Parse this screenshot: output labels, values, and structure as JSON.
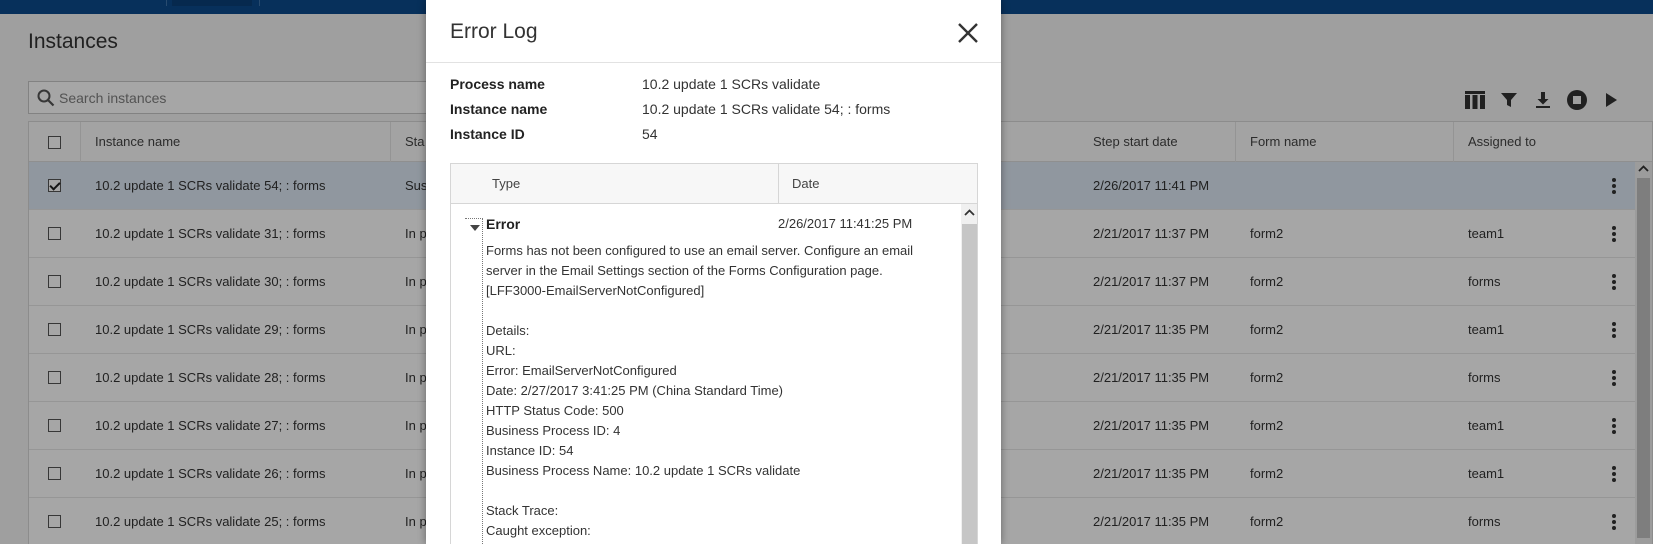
{
  "page": {
    "title": "Instances",
    "search_placeholder": "Search instances"
  },
  "toolbar": {
    "icons": [
      "columns-icon",
      "filter-icon",
      "download-icon",
      "stop-icon",
      "play-icon"
    ]
  },
  "grid": {
    "columns": [
      "Instance name",
      "Sta",
      "Step start date",
      "Form name",
      "Assigned to"
    ],
    "rows": [
      {
        "name": "10.2 update 1 SCRs validate 54; : forms",
        "status": "Sus",
        "step_start": "2/26/2017 11:41 PM",
        "form": "",
        "assigned": "",
        "checked": true
      },
      {
        "name": "10.2 update 1 SCRs validate 31; : forms",
        "status": "In p",
        "step_start": "2/21/2017 11:37 PM",
        "form": "form2",
        "assigned": "team1",
        "checked": false
      },
      {
        "name": "10.2 update 1 SCRs validate 30; : forms",
        "status": "In p",
        "step_start": "2/21/2017 11:37 PM",
        "form": "form2",
        "assigned": "forms",
        "checked": false
      },
      {
        "name": "10.2 update 1 SCRs validate 29; : forms",
        "status": "In p",
        "step_start": "2/21/2017 11:35 PM",
        "form": "form2",
        "assigned": "team1",
        "checked": false
      },
      {
        "name": "10.2 update 1 SCRs validate 28; : forms",
        "status": "In p",
        "step_start": "2/21/2017 11:35 PM",
        "form": "form2",
        "assigned": "forms",
        "checked": false
      },
      {
        "name": "10.2 update 1 SCRs validate 27; : forms",
        "status": "In p",
        "step_start": "2/21/2017 11:35 PM",
        "form": "form2",
        "assigned": "team1",
        "checked": false
      },
      {
        "name": "10.2 update 1 SCRs validate 26; : forms",
        "status": "In p",
        "step_start": "2/21/2017 11:35 PM",
        "form": "form2",
        "assigned": "team1",
        "checked": false
      },
      {
        "name": "10.2 update 1 SCRs validate 25; : forms",
        "status": "In p",
        "step_start": "2/21/2017 11:35 PM",
        "form": "form2",
        "assigned": "forms",
        "checked": false
      }
    ]
  },
  "modal": {
    "title": "Error Log",
    "fields": [
      {
        "label": "Process name",
        "value": "10.2 update 1 SCRs validate"
      },
      {
        "label": "Instance name",
        "value": "10.2 update 1 SCRs validate 54; : forms"
      },
      {
        "label": "Instance ID",
        "value": "54"
      }
    ],
    "log": {
      "columns": [
        "Type",
        "Date"
      ],
      "entry": {
        "type": "Error",
        "date": "2/26/2017 11:41:25 PM",
        "message": "Forms has not been configured to use an email server. Configure an email server in the Email Settings section of the Forms Configuration page. [LFF3000-EmailServerNotConfigured]\n\nDetails:\nURL:\nError: EmailServerNotConfigured\nDate: 2/27/2017 3:41:25 PM (China Standard Time)\nHTTP Status Code: 500\nBusiness Process ID: 4\nInstance ID: 54\nBusiness Process Name: 10.2 update 1 SCRs validate\n\nStack Trace:\nCaught exception:"
      }
    }
  },
  "colors": {
    "topbar": "#0b4a8c",
    "selected_row": "#dde8f4"
  }
}
